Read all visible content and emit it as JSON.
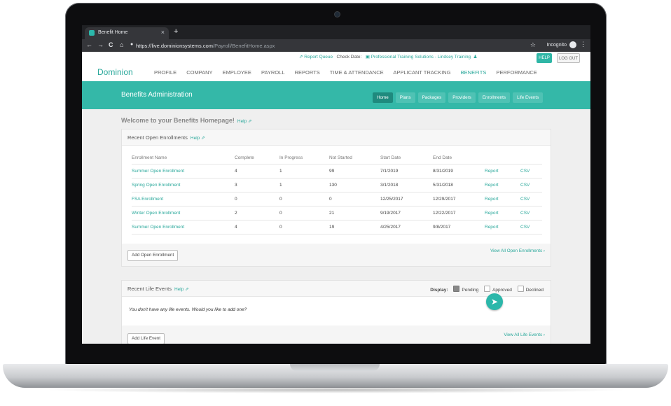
{
  "browser": {
    "tab_title": "Benefit Home",
    "tab_close": "×",
    "new_tab": "+",
    "url_host": "https://live.dominionsystems.com",
    "url_path": "/Payroll/BenefitHome.aspx",
    "incognito": "Incognito",
    "nav_back": "←",
    "nav_forward": "→",
    "nav_reload": "C",
    "nav_home": "⌂",
    "star": "☆",
    "menu": "⋮"
  },
  "utility": {
    "report_queue": "Report Queue",
    "check_date": "Check Date:",
    "company": "Professional Training Solutions - Lindsey Training"
  },
  "header": {
    "help": "HELP",
    "logout": "LOG OUT",
    "brand": "Dominion",
    "nav": [
      "PROFILE",
      "COMPANY",
      "EMPLOYEE",
      "PAYROLL",
      "REPORTS",
      "TIME & ATTENDANCE",
      "APPLICANT TRACKING",
      "BENEFITS",
      "PERFORMANCE"
    ]
  },
  "banner": {
    "title": "Benefits Administration",
    "tabs": [
      "Home",
      "Plans",
      "Packages",
      "Providers",
      "Enrollments",
      "Life Events"
    ]
  },
  "welcome": {
    "text": "Welcome to your Benefits Homepage!",
    "help": "Help"
  },
  "enrollments": {
    "title": "Recent Open Enrollments",
    "help": "Help",
    "columns": [
      "Enrollment Name",
      "Complete",
      "In Progress",
      "Not Started",
      "Start Date",
      "End Date"
    ],
    "rows": [
      {
        "name": "Summer Open Enrollment",
        "complete": "4",
        "in_progress": "1",
        "not_started": "99",
        "start": "7/1/2019",
        "end": "8/31/2019",
        "report": "Report",
        "csv": "CSV"
      },
      {
        "name": "Spring Open Enrollment",
        "complete": "3",
        "in_progress": "1",
        "not_started": "130",
        "start": "3/1/2018",
        "end": "5/31/2018",
        "report": "Report",
        "csv": "CSV"
      },
      {
        "name": "FSA Enrollment",
        "complete": "0",
        "in_progress": "0",
        "not_started": "0",
        "start": "12/25/2017",
        "end": "12/29/2017",
        "report": "Report",
        "csv": "CSV"
      },
      {
        "name": "Winter Open Enrollment",
        "complete": "2",
        "in_progress": "0",
        "not_started": "21",
        "start": "9/19/2017",
        "end": "12/22/2017",
        "report": "Report",
        "csv": "CSV"
      },
      {
        "name": "Summer Open Enrollment",
        "complete": "4",
        "in_progress": "0",
        "not_started": "19",
        "start": "4/25/2017",
        "end": "9/8/2017",
        "report": "Report",
        "csv": "CSV"
      }
    ],
    "add_button": "Add Open Enrollment",
    "view_all": "View All Open Enrollments ›"
  },
  "life_events": {
    "title": "Recent Life Events",
    "help": "Help",
    "display_label": "Display:",
    "filters": [
      {
        "label": "Pending",
        "checked": true
      },
      {
        "label": "Approved",
        "checked": false
      },
      {
        "label": "Declined",
        "checked": false
      }
    ],
    "empty_text": "You don't have any life events. Would you like to add one?",
    "add_button": "Add Life Event",
    "view_all": "View All Life Events ›"
  },
  "colors": {
    "accent": "#34b8a8",
    "accent_dark": "#1f8a7e",
    "link": "#2aa89b"
  }
}
